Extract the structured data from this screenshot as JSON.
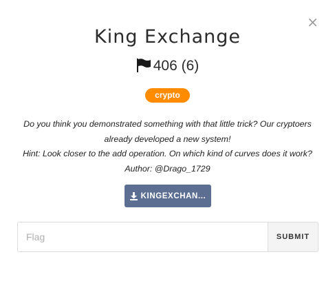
{
  "modal": {
    "close_glyph": "×",
    "title": "King Exchange",
    "score": "406 (6)",
    "category": "crypto",
    "description_lines": [
      "Do you think you demonstrated something with that little trick? Our cryptoers",
      "already developed a new system!",
      "Hint: Look closer to the add operation. On which kind of curves does it work?",
      "Author: @Drago_1729"
    ],
    "download_label": "KINGEXCHAN...",
    "flag_placeholder": "Flag",
    "submit_label": "SUBMIT"
  },
  "colors": {
    "badge": "#ff8c00",
    "download_button": "#5d6e93"
  },
  "icons": {
    "score": "flag-icon",
    "download": "download-icon",
    "close": "close-icon"
  }
}
